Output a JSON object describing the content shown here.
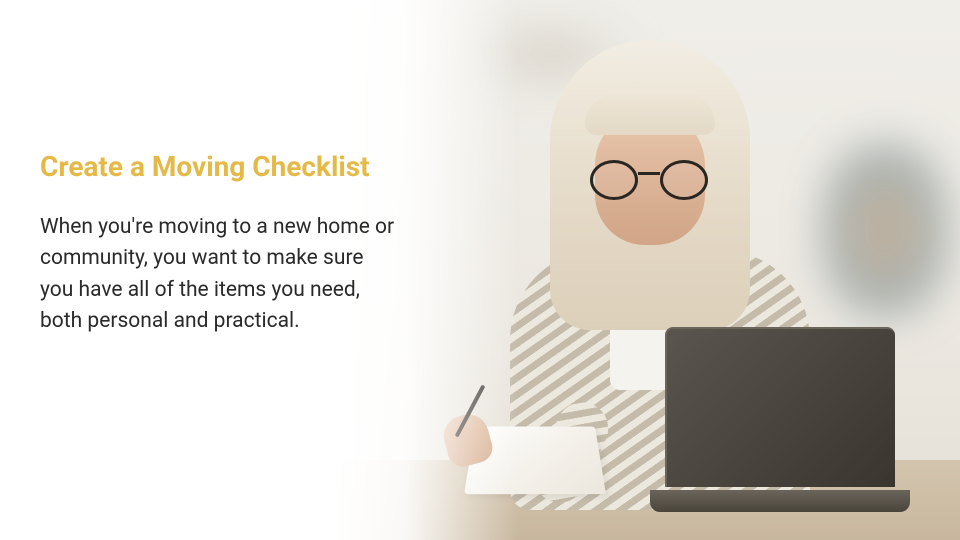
{
  "content": {
    "heading": "Create a Moving Checklist",
    "body": "When you're moving to a new home or community, you want to make sure you have all of the items you need, both personal and practical."
  },
  "colors": {
    "heading": "#e5b946",
    "text": "#2a2a2a"
  }
}
